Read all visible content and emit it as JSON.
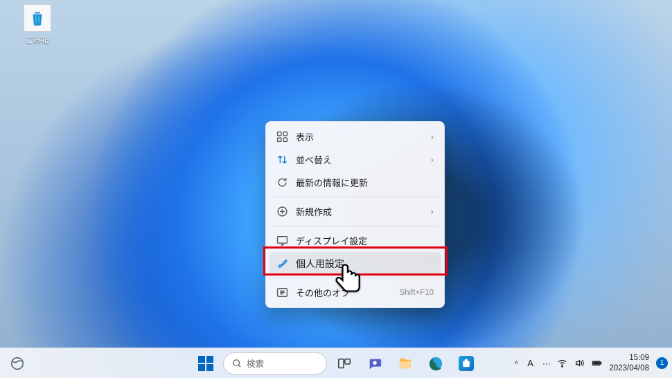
{
  "desktop": {
    "icons": [
      {
        "name": "recycle-bin",
        "label": "ごみ箱"
      }
    ]
  },
  "context_menu": {
    "items": [
      {
        "icon": "grid-icon",
        "label": "表示",
        "submenu": true
      },
      {
        "icon": "sort-icon",
        "label": "並べ替え",
        "submenu": true
      },
      {
        "icon": "refresh-icon",
        "label": "最新の情報に更新"
      },
      {
        "sep": true
      },
      {
        "icon": "plus-icon",
        "label": "新規作成",
        "submenu": true
      },
      {
        "sep": true
      },
      {
        "icon": "display-icon",
        "label": "ディスプレイ設定"
      },
      {
        "icon": "brush-icon",
        "label": "個人用設定",
        "highlighted": true
      },
      {
        "sep": true
      },
      {
        "icon": "more-icon",
        "label": "その他のオプ",
        "shortcut": "Shift+F10"
      }
    ]
  },
  "taskbar": {
    "search_placeholder": "検索",
    "pinned": [
      "task-view",
      "chat",
      "file-explorer",
      "edge",
      "store"
    ]
  },
  "tray": {
    "ime_mode": "A",
    "time": "15:09",
    "date": "2023/04/08",
    "notification_count": "1"
  }
}
